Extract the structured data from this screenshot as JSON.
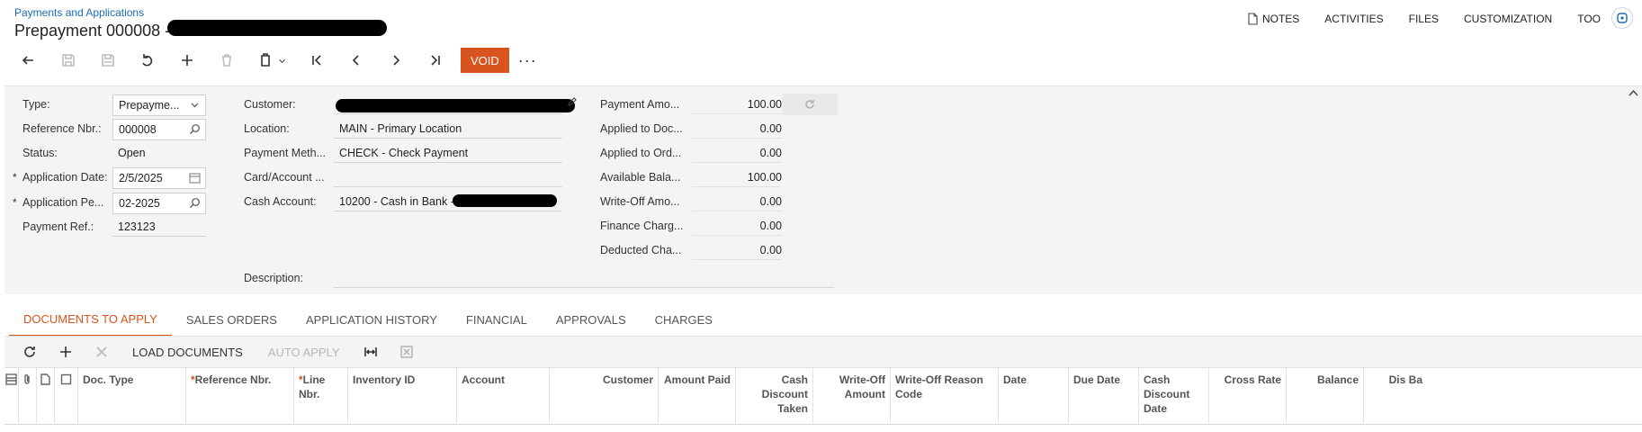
{
  "header": {
    "breadcrumb": "Payments and Applications",
    "title": "Prepayment 000008 - ",
    "title_redacted": true
  },
  "top_links": [
    "NOTES",
    "ACTIVITIES",
    "FILES",
    "CUSTOMIZATION",
    "TOO"
  ],
  "toolbar": {
    "buttons": [
      {
        "name": "back",
        "icon": "arrow-back-icon",
        "enabled": true
      },
      {
        "name": "save-close",
        "icon": "save-close-icon",
        "enabled": false
      },
      {
        "name": "save",
        "icon": "save-icon",
        "enabled": false
      },
      {
        "name": "cancel",
        "icon": "undo-icon",
        "enabled": true
      },
      {
        "name": "add",
        "icon": "plus-icon",
        "enabled": true
      },
      {
        "name": "delete",
        "icon": "trash-icon",
        "enabled": false
      },
      {
        "name": "copy-paste",
        "icon": "clipboard-icon",
        "enabled": true
      },
      {
        "name": "first",
        "icon": "first-record-icon",
        "enabled": true
      },
      {
        "name": "previous",
        "icon": "previous-record-icon",
        "enabled": true
      },
      {
        "name": "next",
        "icon": "next-record-icon",
        "enabled": true
      },
      {
        "name": "last",
        "icon": "last-record-icon",
        "enabled": true
      }
    ],
    "void_label": "VOID",
    "more_label": "···"
  },
  "form": {
    "left": {
      "type_label": "Type:",
      "type_value": "Prepayme...",
      "refnbr_label": "Reference Nbr.:",
      "refnbr_value": "000008",
      "status_label": "Status:",
      "status_value": "Open",
      "appdate_label": "Application Date:",
      "appdate_value": "2/5/2025",
      "appperiod_label": "Application Pe...",
      "appperiod_value": "02-2025",
      "payref_label": "Payment Ref.:",
      "payref_value": "123123"
    },
    "middle": {
      "customer_label": "Customer:",
      "customer_value": "",
      "location_label": "Location:",
      "location_value": "MAIN - Primary Location",
      "paymethod_label": "Payment Meth...",
      "paymethod_value": "CHECK - Check Payment",
      "card_label": "Card/Account ...",
      "card_value": "",
      "cash_label": "Cash Account:",
      "cash_value": "10200 - Cash in Bank -",
      "desc_label": "Description:",
      "desc_value": ""
    },
    "right": [
      {
        "label": "Payment Amo...",
        "value": "100.00"
      },
      {
        "label": "Applied to Doc...",
        "value": "0.00"
      },
      {
        "label": "Applied to Ord...",
        "value": "0.00"
      },
      {
        "label": "Available Bala...",
        "value": "100.00"
      },
      {
        "label": "Write-Off Amo...",
        "value": "0.00"
      },
      {
        "label": "Finance Charg...",
        "value": "0.00"
      },
      {
        "label": "Deducted Cha...",
        "value": "0.00"
      }
    ],
    "required_marker": "*"
  },
  "tabs": [
    "DOCUMENTS TO APPLY",
    "SALES ORDERS",
    "APPLICATION HISTORY",
    "FINANCIAL",
    "APPROVALS",
    "CHARGES"
  ],
  "grid_toolbar": {
    "load_documents": "LOAD DOCUMENTS",
    "auto_apply": "AUTO APPLY"
  },
  "grid_columns": {
    "doc_type": "Doc. Type",
    "ref_nbr": "Reference Nbr.",
    "line_nbr": "Line Nbr.",
    "inventory_id": "Inventory ID",
    "account": "Account",
    "customer": "Customer",
    "amount_paid": "Amount Paid",
    "cash_disc_taken": "Cash Discount Taken",
    "writeoff_amount": "Write-Off Amount",
    "writeoff_reason": "Write-Off Reason Code",
    "date": "Date",
    "due_date": "Due Date",
    "cash_disc_date": "Cash Discount Date",
    "cross_rate": "Cross Rate",
    "balance": "Balance",
    "disc_bal": "Dis Ba"
  },
  "colors": {
    "accent": "#d9531e",
    "link": "#1a6bb5",
    "form_bg": "#f4f4f4"
  }
}
